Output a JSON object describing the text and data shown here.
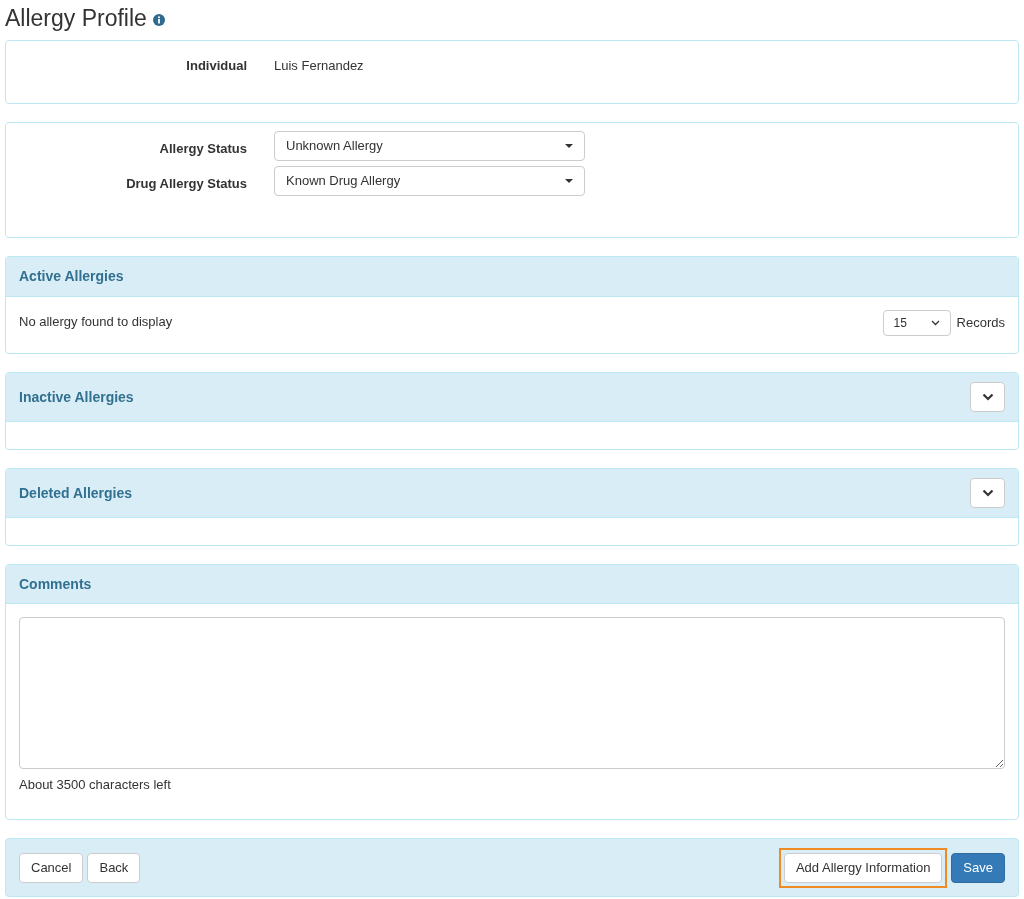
{
  "title": "Allergy Profile",
  "individual": {
    "label": "Individual",
    "value": "Luis Fernandez"
  },
  "status_fields": [
    {
      "label": "Allergy Status",
      "value": "Unknown Allergy"
    },
    {
      "label": "Drug Allergy Status",
      "value": "Known Drug Allergy"
    }
  ],
  "active_allergies": {
    "title": "Active Allergies",
    "message": "No allergy found to display",
    "page_size": "15",
    "records_label": "Records"
  },
  "collapsible_panels": [
    {
      "title": "Inactive Allergies",
      "expanded": false
    },
    {
      "title": "Deleted Allergies",
      "expanded": false
    }
  ],
  "comments": {
    "title": "Comments",
    "counter": "About 3500 characters left"
  },
  "footer": {
    "left_buttons": [
      {
        "label": "Cancel",
        "kind": "default",
        "highlighted": false
      },
      {
        "label": "Back",
        "kind": "default",
        "highlighted": false
      }
    ],
    "right_buttons": [
      {
        "label": "Add Allergy Information",
        "kind": "default",
        "highlighted": true
      },
      {
        "label": "Save",
        "kind": "primary",
        "highlighted": false
      }
    ]
  }
}
